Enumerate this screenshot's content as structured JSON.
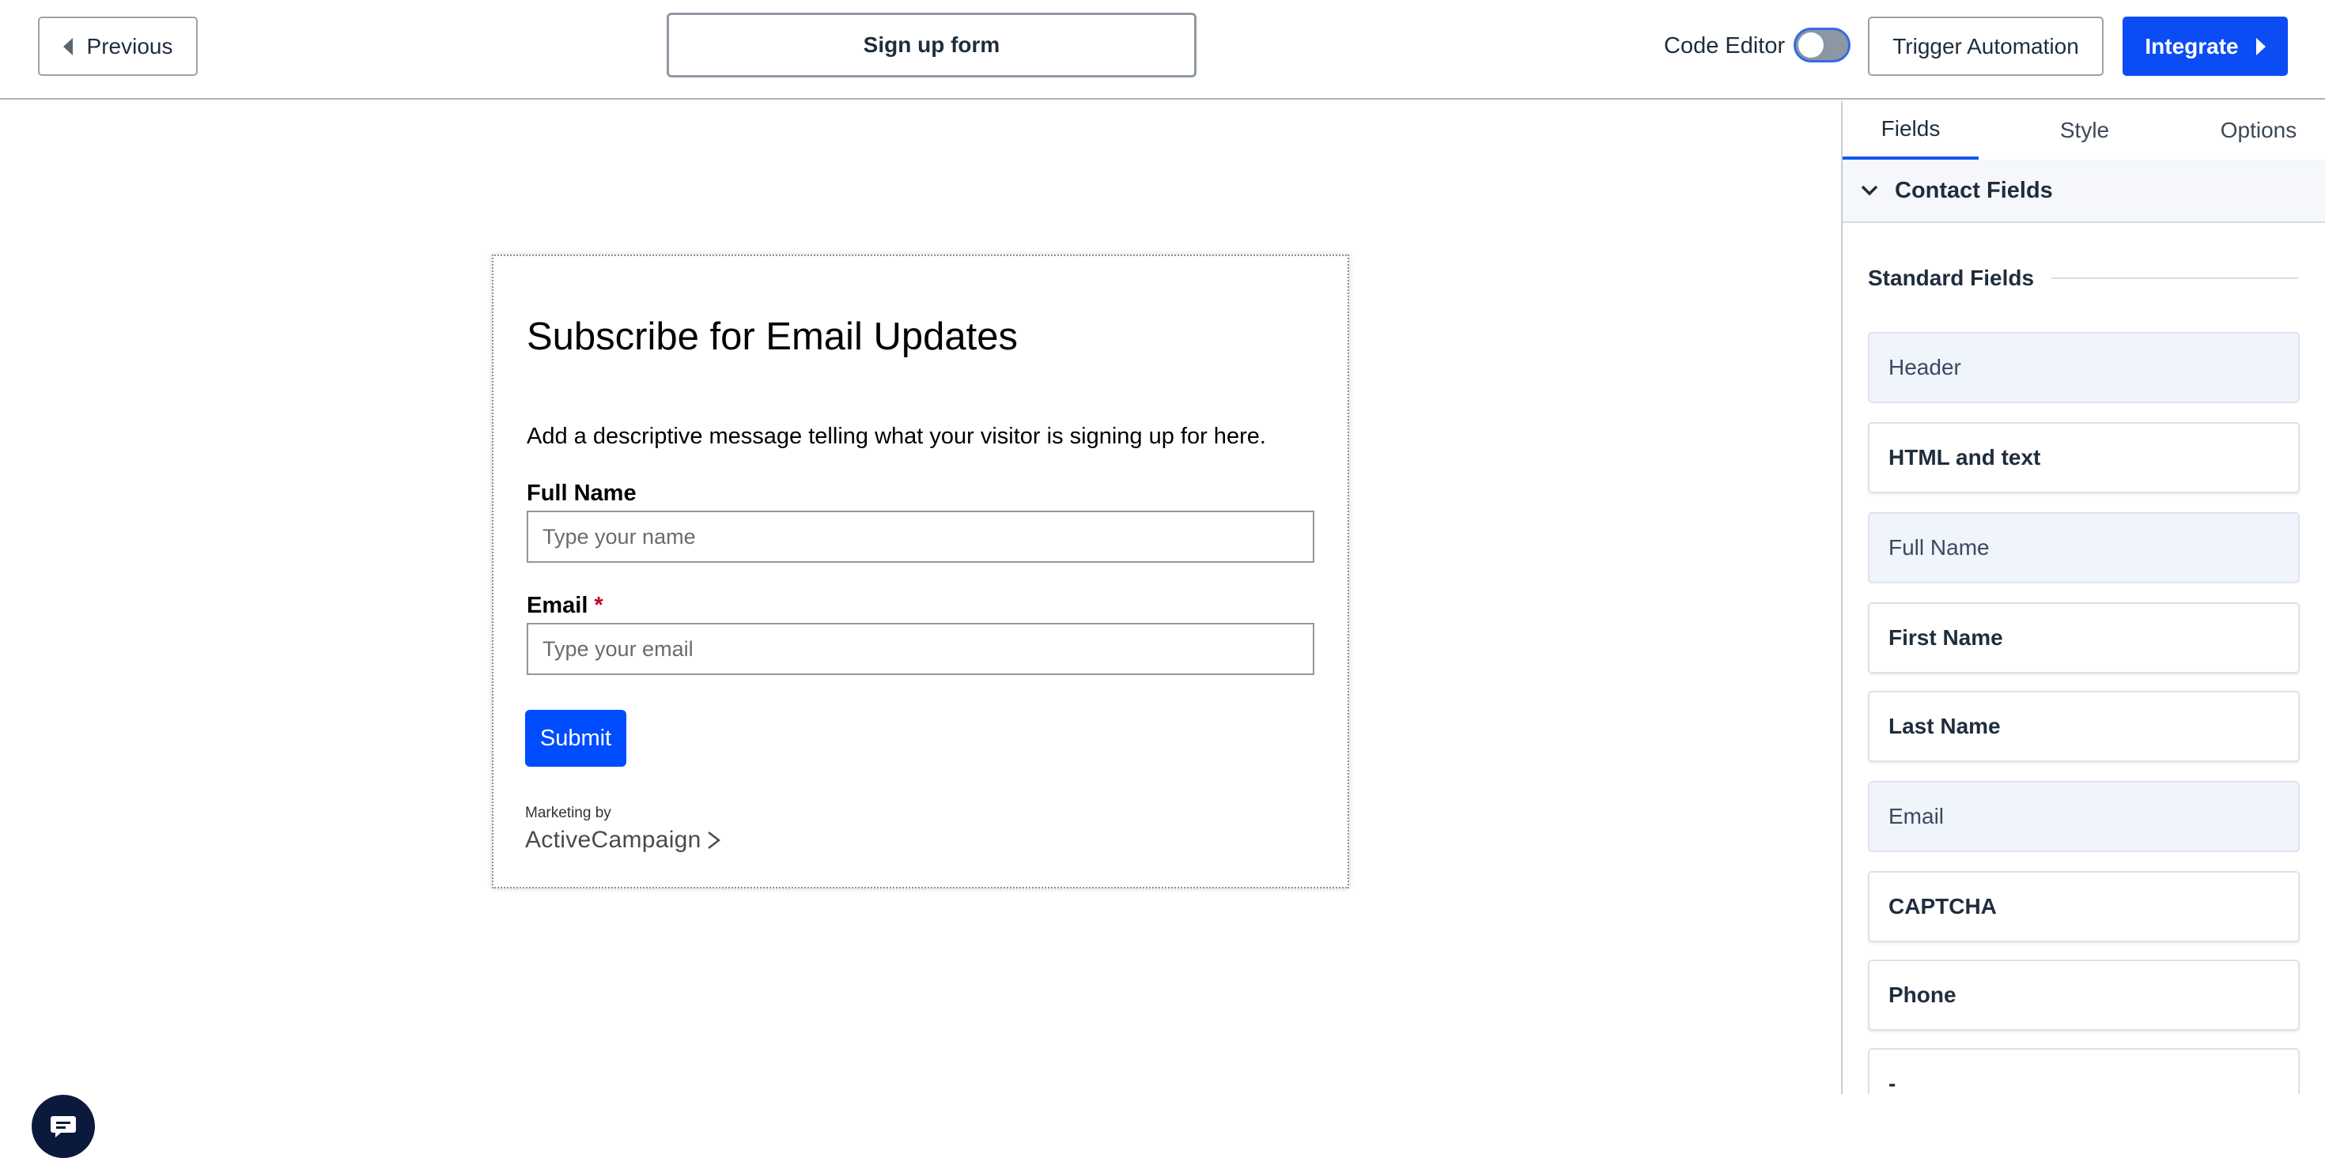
{
  "header": {
    "previous_label": "Previous",
    "form_name": "Sign up form",
    "code_editor_label": "Code Editor",
    "code_editor_enabled": false,
    "trigger_label": "Trigger Automation",
    "integrate_label": "Integrate",
    "accent_color": "#0c4cf5"
  },
  "form": {
    "title": "Subscribe for Email Updates",
    "description": "Add a descriptive message telling what your visitor is signing up for here.",
    "fields": [
      {
        "label": "Full Name",
        "placeholder": "Type your name",
        "required": false
      },
      {
        "label": "Email",
        "placeholder": "Type your email",
        "required": true
      }
    ],
    "required_mark": "*",
    "submit_label": "Submit",
    "powered_small": "Marketing by",
    "powered_brand": "ActiveCampaign"
  },
  "panel": {
    "tabs": [
      {
        "label": "Fields",
        "active": true
      },
      {
        "label": "Style",
        "active": false
      },
      {
        "label": "Options",
        "active": false
      }
    ],
    "section_label": "Contact Fields",
    "standard_label": "Standard Fields",
    "items": [
      {
        "label": "Header",
        "in_use": true
      },
      {
        "label": "HTML and text",
        "in_use": false
      },
      {
        "label": "Full Name",
        "in_use": true
      },
      {
        "label": "First Name",
        "in_use": false
      },
      {
        "label": "Last Name",
        "in_use": false
      },
      {
        "label": "Email",
        "in_use": true
      },
      {
        "label": "CAPTCHA",
        "in_use": false
      },
      {
        "label": "Phone",
        "in_use": false
      },
      {
        "label": "-",
        "in_use": false
      }
    ]
  },
  "icons": {
    "previous": "caret-left-icon",
    "integrate": "caret-right-icon",
    "section": "chevron-down-icon",
    "chat": "chat-icon",
    "brand": "chevron-right-icon"
  }
}
